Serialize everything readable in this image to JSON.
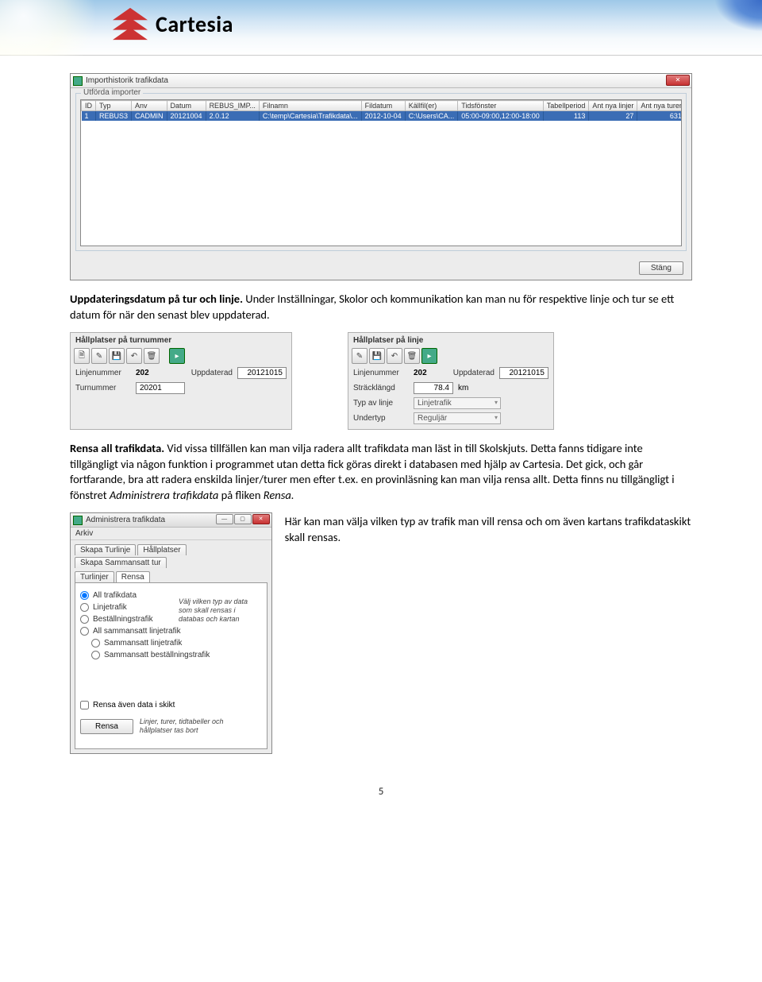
{
  "logo_text": "Cartesia",
  "window1": {
    "title": "Importhistorik trafikdata",
    "groupbox_title": "Utförda importer",
    "columns": [
      "ID",
      "Typ",
      "Anv",
      "Datum",
      "REBUS_IMP...",
      "Filnamn",
      "Fildatum",
      "Källfil(er)",
      "Tidsfönster",
      "Tabellperiod",
      "Ant nya linjer",
      "Ant nya turer"
    ],
    "row": [
      "1",
      "REBUS3",
      "CADMIN",
      "20121004",
      "2.0.12",
      "C:\\temp\\Cartesia\\Trafikdata\\...",
      "2012-10-04",
      "C:\\Users\\CA...",
      "05:00-09:00,12:00-18:00",
      "113",
      "27",
      "631"
    ],
    "close_button": "Stäng"
  },
  "para1": {
    "heading": "Uppdateringsdatum på tur och linje.",
    "text": " Under Inställningar, Skolor och kommunikation kan man nu för respektive linje och tur se ett datum för när den senast blev uppdaterad."
  },
  "panelA": {
    "title": "Hållplatser på turnummer",
    "linjenummer_label": "Linjenummer",
    "linjenummer": "202",
    "uppdaterad_label": "Uppdaterad",
    "uppdaterad": "20121015",
    "turnummer_label": "Turnummer",
    "turnummer": "20201"
  },
  "panelB": {
    "title": "Hållplatser på linje",
    "linjenummer_label": "Linjenummer",
    "linjenummer": "202",
    "uppdaterad_label": "Uppdaterad",
    "uppdaterad": "20121015",
    "strack_label": "Sträcklängd",
    "strack": "78.4",
    "strack_unit": "km",
    "typ_label": "Typ av linje",
    "typ": "Linjetrafik",
    "undertyp_label": "Undertyp",
    "undertyp": "Reguljär"
  },
  "para2": {
    "heading": "Rensa all trafikdata.",
    "text": " Vid vissa tillfällen kan man vilja radera allt trafikdata man läst in till Skolskjuts. Detta fanns tidigare inte tillgängligt via någon funktion i programmet utan detta fick göras direkt i databasen med hjälp av Cartesia. Det gick, och går fortfarande, bra att radera enskilda linjer/turer men efter t.ex. en provinläsning kan man vilja rensa allt. Detta finns nu tillgängligt i fönstret ",
    "italic1": "Administrera trafikdata",
    "text2": " på fliken ",
    "italic2": "Rensa."
  },
  "admin": {
    "title": "Administrera trafikdata",
    "menu": "Arkiv",
    "tabs_row1": [
      "Skapa Turlinje",
      "Hållplatser",
      "Skapa Sammansatt tur"
    ],
    "tabs_row2": [
      "Turlinjer",
      "Rensa"
    ],
    "radios": [
      "All trafikdata",
      "Linjetrafik",
      "Beställningstrafik",
      "All sammansatt linjetrafik"
    ],
    "radios_sub": [
      "Sammansatt linjetrafik",
      "Sammansatt beställningstrafik"
    ],
    "help_text": "Välj vilken typ av data som skall rensas i databas och kartan",
    "checkbox": "Rensa även data i skikt",
    "button": "Rensa",
    "bottom_help": "Linjer, turer, tidtabeller och hållplatser tas bort"
  },
  "side_text": "Här kan man välja vilken typ av trafik man vill rensa och om även kartans trafikdataskikt skall rensas.",
  "page_number": "5"
}
